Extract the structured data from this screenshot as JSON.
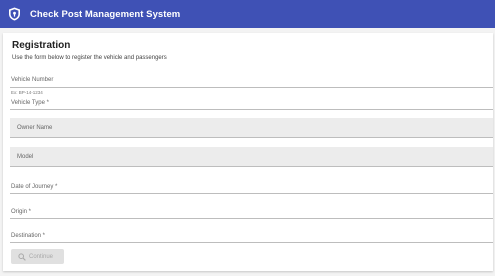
{
  "app": {
    "title": "Check Post Management System"
  },
  "form": {
    "heading": "Registration",
    "subtitle": "Use the form below to register the vehicle and passengers",
    "fields": {
      "vehicle_number": {
        "label": "Vehicle Number",
        "helper": "Ex: BP-14-1234"
      },
      "vehicle_type": {
        "label": "Vehicle Type *"
      },
      "owner_name": {
        "label": "Owner Name"
      },
      "model": {
        "label": "Model"
      },
      "date_of_journey": {
        "label": "Date of Journey *"
      },
      "origin": {
        "label": "Origin *"
      },
      "destination": {
        "label": "Destination *"
      }
    },
    "continue_button": {
      "label": "Continue",
      "disabled": true,
      "icon": "search-icon"
    }
  },
  "colors": {
    "primary": "#3f51b5",
    "background": "#f3f3f3",
    "filled_field": "#ececec"
  }
}
